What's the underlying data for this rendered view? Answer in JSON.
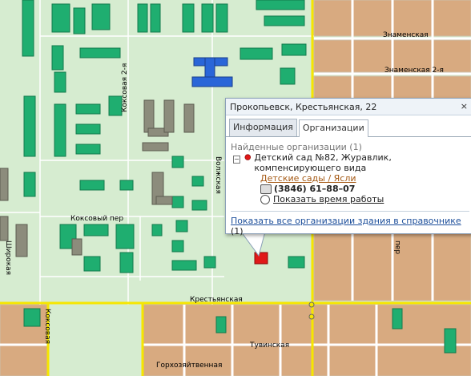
{
  "map": {
    "streets": {
      "znamenskaya": "Знаменская",
      "znamenskaya2": "Знаменская 2-я",
      "koksovaya2": "Коксовая 2-я",
      "volzhskaya": "Волжская",
      "koksovy_per": "Коксовый пер",
      "krestyanskaya": "Крестьянская",
      "tuvinskaya": "Тувинская",
      "gorkhozyaystvennaya": "Горхозяйтвенная",
      "koksovaya": "Коксовая",
      "shirokaya": "Широкая",
      "per": "пер"
    },
    "colors": {
      "park": "#d6ecd0",
      "block": "#d8aa80",
      "building_green": "#1fae70",
      "building_gray": "#8c8c7c",
      "building_blue": "#2a66d8",
      "road_main": "#f6e600",
      "road": "#ffffff"
    }
  },
  "popup": {
    "title": "Прокопьевск, Крестьянская, 22",
    "close": "×",
    "tabs": [
      "Информация",
      "Организации"
    ],
    "active_tab": 1,
    "found": "Найденные организации (1)",
    "org_name": "Детский сад №82, Журавлик, компенсирующего вида",
    "category": "Детские сады / Ясли",
    "phone": "(3846) 61–88–07",
    "hours_link": "Показать время работы",
    "all_link": "Показать все организации здания в справочнике",
    "all_count": "(1)"
  }
}
